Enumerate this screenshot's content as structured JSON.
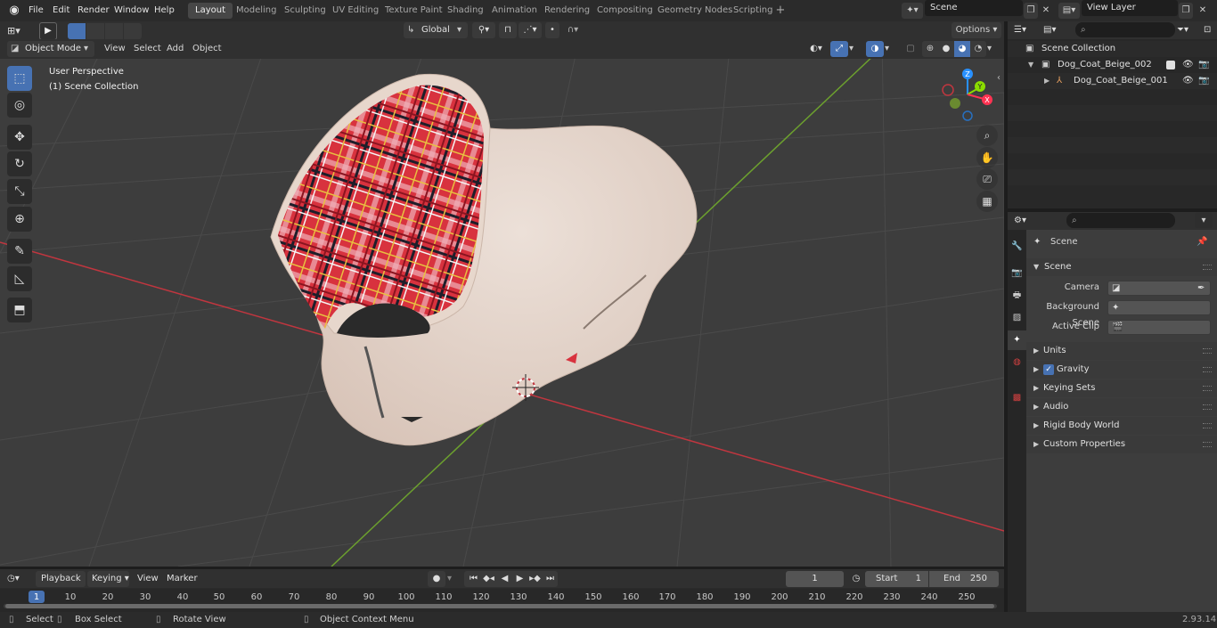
{
  "topbar": {
    "menus": [
      "File",
      "Edit",
      "Render",
      "Window",
      "Help"
    ],
    "workspaces": [
      "Layout",
      "Modeling",
      "Sculpting",
      "UV Editing",
      "Texture Paint",
      "Shading",
      "Animation",
      "Rendering",
      "Compositing",
      "Geometry Nodes",
      "Scripting"
    ],
    "active_workspace": "Layout",
    "add_workspace": "+",
    "scene_name": "Scene",
    "view_layer_name": "View Layer"
  },
  "header3d": {
    "mode": "Object Mode",
    "menus": [
      "View",
      "Select",
      "Add",
      "Object"
    ],
    "orientation": "Global",
    "options": "Options"
  },
  "viewport": {
    "perspective": "User Perspective",
    "collection": "(1) Scene Collection",
    "gizmo_axes": [
      "Z",
      "Y",
      "X"
    ]
  },
  "outliner": {
    "root": "Scene Collection",
    "items": [
      {
        "name": "Dog_Coat_Beige_002",
        "level": 1
      },
      {
        "name": "Dog_Coat_Beige_001",
        "level": 2
      }
    ]
  },
  "properties": {
    "context": "Scene",
    "panel": "Scene",
    "fields": [
      {
        "label": "Camera"
      },
      {
        "label": "Background Scene"
      },
      {
        "label": "Active Clip"
      }
    ],
    "subpanels": [
      "Units",
      "Gravity",
      "Keying Sets",
      "Audio",
      "Rigid Body World",
      "Custom Properties"
    ],
    "gravity_checked": true
  },
  "timeline": {
    "menus": [
      "Playback",
      "Keying",
      "View",
      "Marker"
    ],
    "current_frame": "1",
    "start_label": "Start",
    "start": "1",
    "end_label": "End",
    "end": "250",
    "ticks": [
      "1",
      "10",
      "20",
      "30",
      "40",
      "50",
      "60",
      "70",
      "80",
      "90",
      "100",
      "110",
      "120",
      "130",
      "140",
      "150",
      "160",
      "170",
      "180",
      "190",
      "200",
      "210",
      "220",
      "230",
      "240",
      "250"
    ]
  },
  "statusbar": {
    "select": "Select",
    "box_select": "Box Select",
    "rotate": "Rotate View",
    "context_menu": "Object Context Menu",
    "version": "2.93.14"
  },
  "colors": {
    "accent": "#4772b3",
    "axis_x": "#ff3352",
    "axis_y": "#8bdc00",
    "axis_z": "#2890ff",
    "plaid_red": "#d8323e",
    "coat_beige": "#e6d6cc"
  }
}
